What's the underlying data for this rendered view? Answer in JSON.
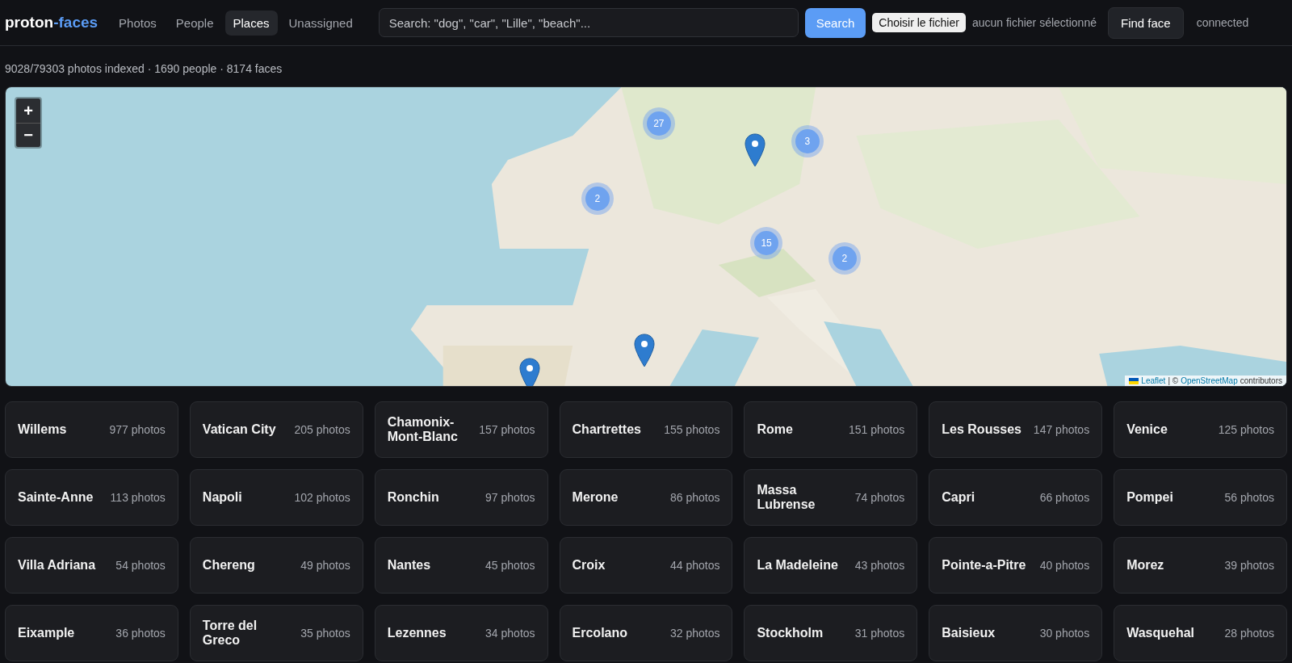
{
  "header": {
    "logo": {
      "main": "proton",
      "accent": "-faces"
    },
    "tabs": [
      {
        "label": "Photos",
        "selected": false
      },
      {
        "label": "People",
        "selected": false
      },
      {
        "label": "Places",
        "selected": true
      },
      {
        "label": "Unassigned",
        "selected": false
      }
    ],
    "search": {
      "placeholder": "Search: \"dog\", \"car\", \"Lille\", \"beach\"..."
    },
    "search_button": "Search",
    "file_button": "Choisir le fichier",
    "file_status": "aucun fichier sélectionné",
    "find_face_button": "Find face",
    "connection": "connected"
  },
  "stats": "9028/79303 photos indexed · 1690 people · 8174 faces",
  "map": {
    "zoom_in": "+",
    "zoom_out": "−",
    "markers": [
      {
        "kind": "cluster",
        "count": "27"
      },
      {
        "kind": "cluster",
        "count": "3"
      },
      {
        "kind": "cluster",
        "count": "2"
      },
      {
        "kind": "cluster",
        "count": "15"
      },
      {
        "kind": "cluster",
        "count": "2"
      },
      {
        "kind": "pin"
      },
      {
        "kind": "pin"
      },
      {
        "kind": "pin"
      }
    ],
    "attribution": {
      "leaflet": "Leaflet",
      "separator": "| ©",
      "osm": "OpenStreetMap",
      "rest": "contributors"
    }
  },
  "places": [
    {
      "name": "Willems",
      "count": "977 photos"
    },
    {
      "name": "Vatican City",
      "count": "205 photos"
    },
    {
      "name": "Chamonix-Mont-Blanc",
      "count": "157 photos"
    },
    {
      "name": "Chartrettes",
      "count": "155 photos"
    },
    {
      "name": "Rome",
      "count": "151 photos"
    },
    {
      "name": "Les Rousses",
      "count": "147 photos"
    },
    {
      "name": "Venice",
      "count": "125 photos"
    },
    {
      "name": "Sainte-Anne",
      "count": "113 photos"
    },
    {
      "name": "Napoli",
      "count": "102 photos"
    },
    {
      "name": "Ronchin",
      "count": "97 photos"
    },
    {
      "name": "Merone",
      "count": "86 photos"
    },
    {
      "name": "Massa Lubrense",
      "count": "74 photos"
    },
    {
      "name": "Capri",
      "count": "66 photos"
    },
    {
      "name": "Pompei",
      "count": "56 photos"
    },
    {
      "name": "Villa Adriana",
      "count": "54 photos"
    },
    {
      "name": "Chereng",
      "count": "49 photos"
    },
    {
      "name": "Nantes",
      "count": "45 photos"
    },
    {
      "name": "Croix",
      "count": "44 photos"
    },
    {
      "name": "La Madeleine",
      "count": "43 photos"
    },
    {
      "name": "Pointe-a-Pitre",
      "count": "40 photos"
    },
    {
      "name": "Morez",
      "count": "39 photos"
    },
    {
      "name": "Eixample",
      "count": "36 photos"
    },
    {
      "name": "Torre del Greco",
      "count": "35 photos"
    },
    {
      "name": "Lezennes",
      "count": "34 photos"
    },
    {
      "name": "Ercolano",
      "count": "32 photos"
    },
    {
      "name": "Stockholm",
      "count": "31 photos"
    },
    {
      "name": "Baisieux",
      "count": "30 photos"
    },
    {
      "name": "Wasquehal",
      "count": "28 photos"
    }
  ]
}
